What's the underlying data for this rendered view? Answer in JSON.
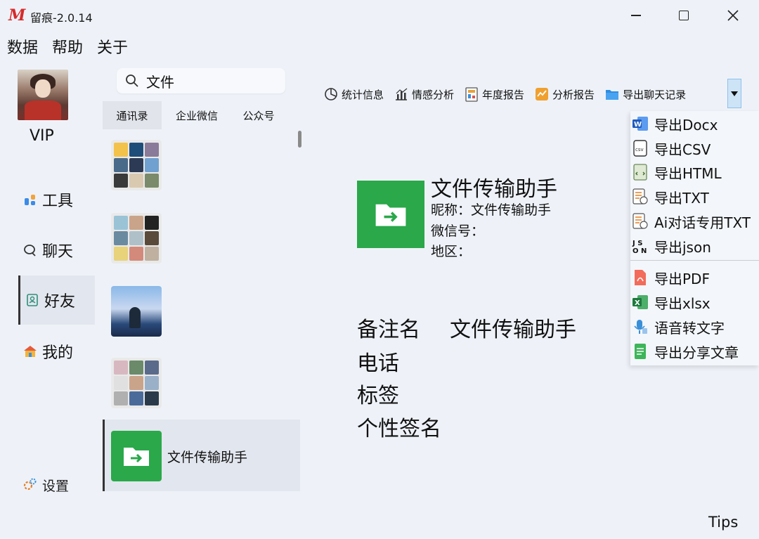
{
  "window": {
    "logo": "M",
    "title": "留痕-2.0.14"
  },
  "menu": [
    "数据",
    "帮助",
    "关于"
  ],
  "user": {
    "level": "VIP"
  },
  "nav": [
    {
      "label": "工具",
      "icon": "tools-icon"
    },
    {
      "label": "聊天",
      "icon": "chat-icon"
    },
    {
      "label": "好友",
      "icon": "contacts-icon",
      "active": true
    },
    {
      "label": "我的",
      "icon": "home-icon"
    }
  ],
  "settings": {
    "label": "设置"
  },
  "search": {
    "value": "文件"
  },
  "tabs": [
    "通讯录",
    "企业微信",
    "公众号"
  ],
  "contacts": {
    "selected_name": "文件传输助手"
  },
  "toolbar": [
    "统计信息",
    "情感分析",
    "年度报告",
    "分析报告",
    "导出聊天记录"
  ],
  "export_menu": [
    {
      "label": "导出Docx",
      "icon": "word-icon"
    },
    {
      "label": "导出CSV",
      "icon": "csv-icon"
    },
    {
      "label": "导出HTML",
      "icon": "html-icon"
    },
    {
      "label": "导出TXT",
      "icon": "txt-icon"
    },
    {
      "label": "Ai对话专用TXT",
      "icon": "ai-txt-icon"
    },
    {
      "label": "导出json",
      "icon": "json-icon"
    },
    {
      "label": "导出PDF",
      "icon": "pdf-icon"
    },
    {
      "label": "导出xlsx",
      "icon": "excel-icon"
    },
    {
      "label": "语音转文字",
      "icon": "voice-icon"
    },
    {
      "label": "导出分享文章",
      "icon": "article-icon"
    }
  ],
  "profile": {
    "name": "文件传输助手",
    "nickname_line": "昵称：文件传输助手",
    "wechat_id_line": "微信号：",
    "region_line": "地区："
  },
  "details": {
    "remark_label": "备注名",
    "remark_value": "文件传输助手",
    "phone_label": "电话",
    "tag_label": "标签",
    "signature_label": "个性签名"
  },
  "footer": {
    "tips": "Tips"
  },
  "colors": {
    "file_helper_green": "#2aa84a",
    "accent_red": "#d62b2b",
    "dropdown_blue": "#cde4f7"
  }
}
